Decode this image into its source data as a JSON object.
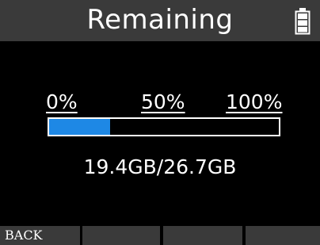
{
  "title": "Remaining",
  "status": {
    "battery_icon": "battery-full-icon",
    "battery_color": "#ffffff"
  },
  "progress": {
    "scale_labels": [
      "0%",
      "50%",
      "100%"
    ],
    "fill_fraction": 0.267,
    "fill_color": "#1e88e5"
  },
  "storage": {
    "text": "19.4GB/26.7GB"
  },
  "softkeys": [
    {
      "label": "BACK"
    },
    {
      "label": ""
    },
    {
      "label": ""
    },
    {
      "label": ""
    }
  ]
}
